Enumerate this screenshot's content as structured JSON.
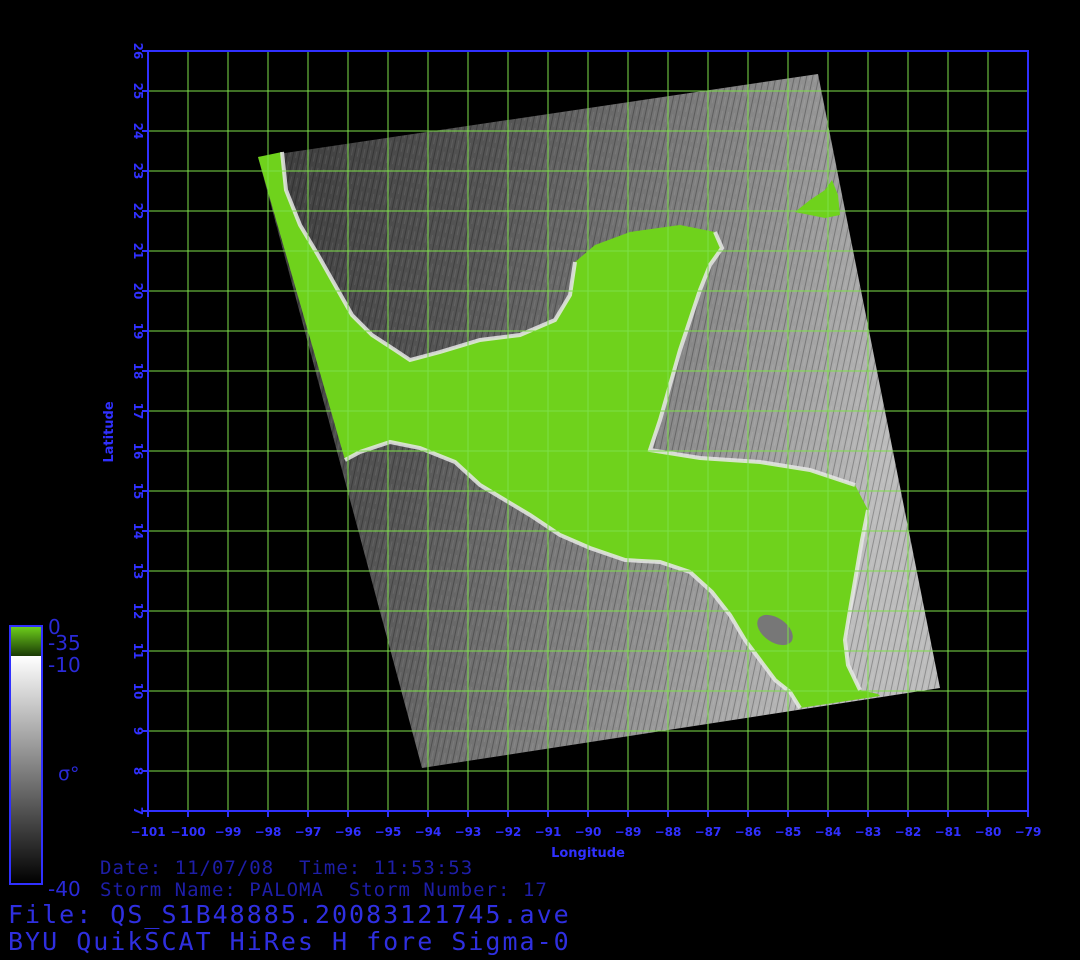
{
  "map": {
    "axes": {
      "x_label": "Longitude",
      "y_label": "Latitude",
      "x_range": [
        -101,
        -79
      ],
      "y_range": [
        7,
        26
      ],
      "x_ticks": [
        "-101",
        "-100",
        "-99",
        "-98",
        "-97",
        "-96",
        "-95",
        "-94",
        "-93",
        "-92",
        "-91",
        "-90",
        "-89",
        "-88",
        "-87",
        "-86",
        "-85",
        "-84",
        "-83",
        "-82",
        "-81",
        "-80",
        "-79"
      ],
      "y_ticks": [
        "7",
        "8",
        "9",
        "10",
        "11",
        "12",
        "13",
        "14",
        "15",
        "16",
        "17",
        "18",
        "19",
        "20",
        "21",
        "22",
        "23",
        "24",
        "25",
        "26"
      ],
      "grid": true,
      "grid_color": "#7ee04a",
      "frame_color": "#3030ff"
    },
    "swath_corners_lonlat": [
      [
        -98.2,
        23.3
      ],
      [
        -84.2,
        25.4
      ],
      [
        -80.8,
        10.1
      ],
      [
        -94.0,
        8.0
      ]
    ],
    "land_color": "#6fd21c",
    "ocean_color_range": [
      "#111111",
      "#e6e6e6"
    ]
  },
  "colorbar": {
    "land_top": "0",
    "land_bottom": "-35",
    "ocean_top": "-10",
    "ocean_bottom": "-40",
    "symbol": "σ°",
    "land_color": "#6fd21c",
    "frame_color": "#3030ff"
  },
  "info": {
    "date_line": "Date: 11/07/08  Time: 11:53:53",
    "storm_line": "Storm Name: PALOMA  Storm Number: 17",
    "file_line": "File: QS_S1B48885.20083121745.ave",
    "product_line": "BYU QuikSCAT HiRes H fore Sigma-0"
  }
}
